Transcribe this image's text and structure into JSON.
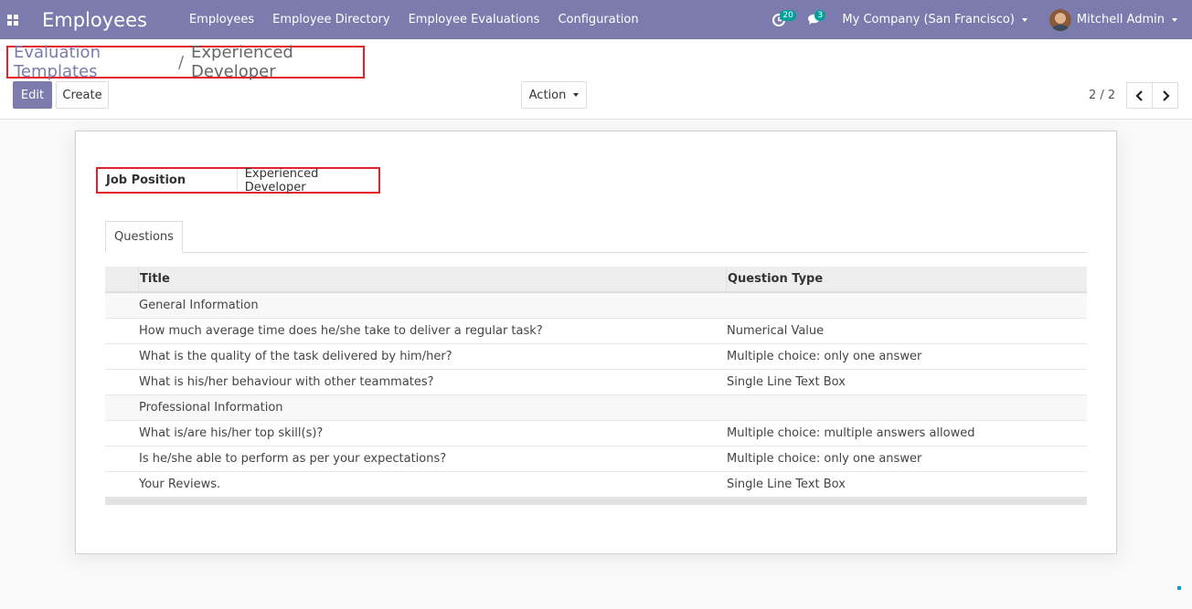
{
  "navbar": {
    "app_title": "Employees",
    "menu": [
      "Employees",
      "Employee Directory",
      "Employee Evaluations",
      "Configuration"
    ],
    "activity_count": "20",
    "message_count": "3",
    "company": "My Company (San Francisco)",
    "user": "Mitchell Admin"
  },
  "breadcrumb": {
    "parent": "Evaluation Templates",
    "separator": "/",
    "current": "Experienced Developer"
  },
  "toolbar": {
    "edit_label": "Edit",
    "create_label": "Create",
    "action_label": "Action",
    "pager": "2 / 2"
  },
  "form": {
    "job_position_label": "Job Position",
    "job_position_value": "Experienced Developer",
    "tab_label": "Questions",
    "table": {
      "headers": [
        "Title",
        "Question Type"
      ],
      "rows": [
        {
          "title": "General Information",
          "type": "",
          "section": true
        },
        {
          "title": "How much average time does he/she take to deliver a regular task?",
          "type": "Numerical Value",
          "section": false
        },
        {
          "title": "What is the quality of the task delivered by him/her?",
          "type": "Multiple choice: only one answer",
          "section": false
        },
        {
          "title": "What is his/her behaviour with other teammates?",
          "type": "Single Line Text Box",
          "section": false
        },
        {
          "title": "Professional Information",
          "type": "",
          "section": true
        },
        {
          "title": "What is/are his/her top skill(s)?",
          "type": "Multiple choice: multiple answers allowed",
          "section": false
        },
        {
          "title": "Is he/she able to perform as per your expectations?",
          "type": "Multiple choice: only one answer",
          "section": false
        },
        {
          "title": "Your Reviews.",
          "type": "Single Line Text Box",
          "section": false
        }
      ]
    }
  },
  "colors": {
    "brand": "#7c7bad",
    "highlight": "#e5202b",
    "badge": "#00a09d"
  }
}
